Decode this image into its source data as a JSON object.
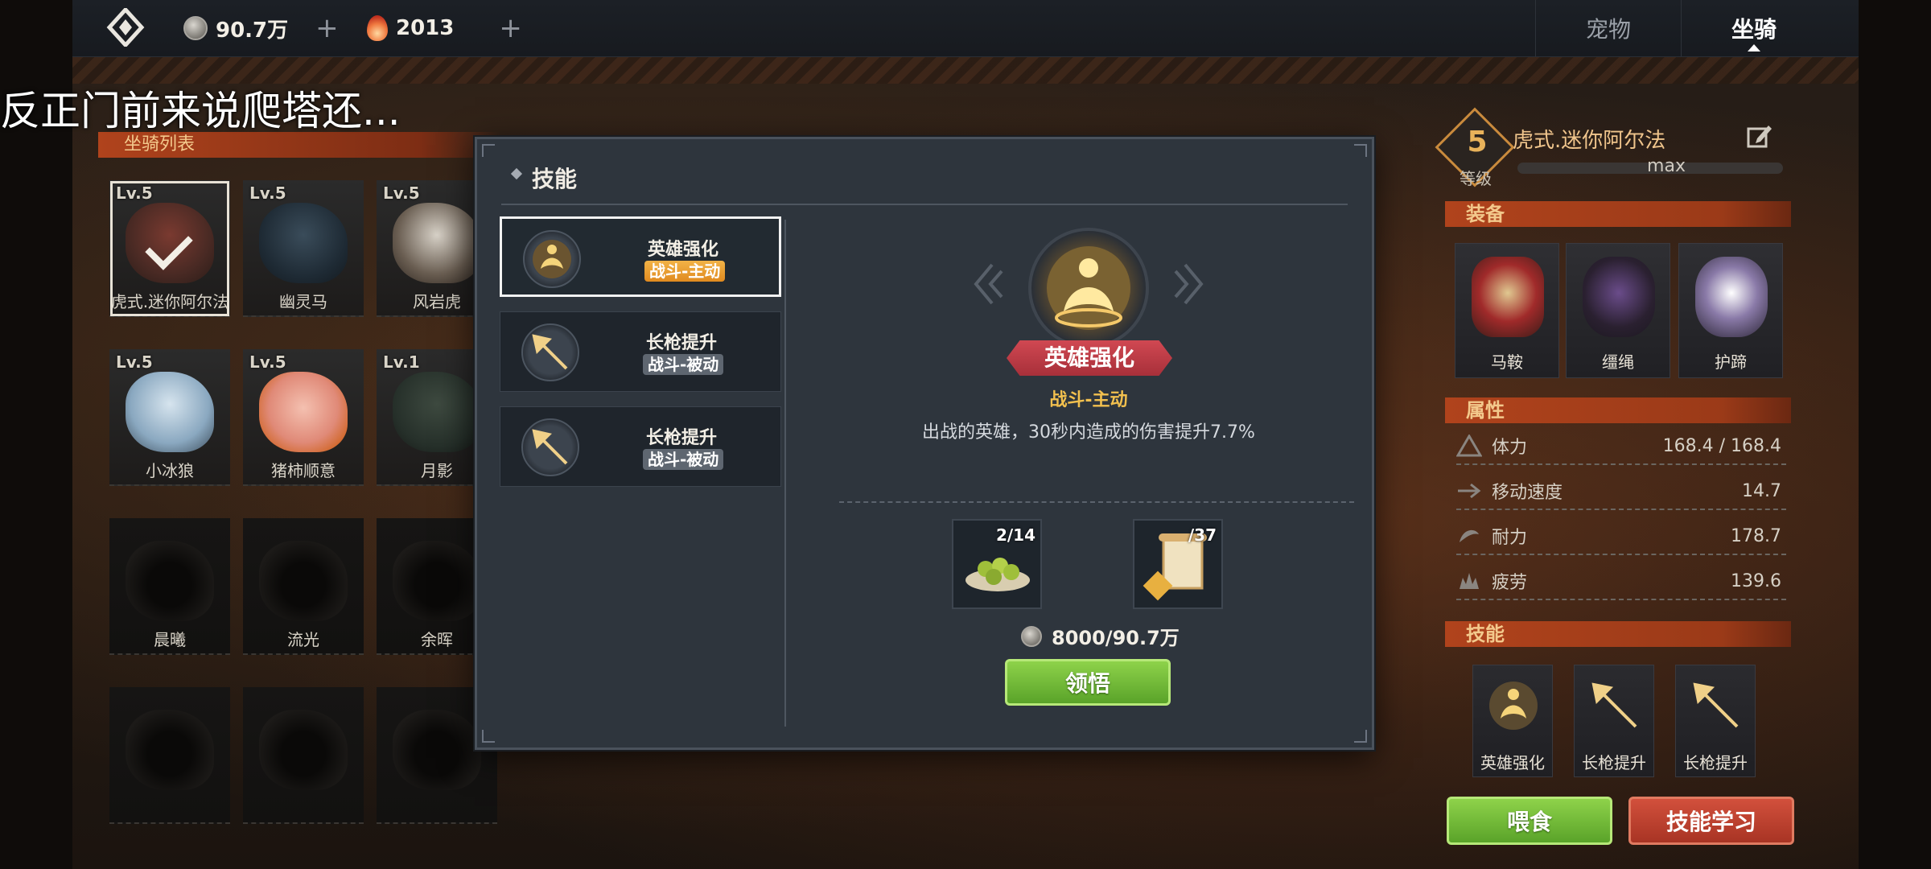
{
  "topbar": {
    "currency_silver": "90.7万",
    "currency_crystal": "2013",
    "plus": "+",
    "tabs": [
      {
        "label": "宠物",
        "active": false
      },
      {
        "label": "坐骑",
        "active": true
      }
    ]
  },
  "subtitle": "反正门前来说爬塔还...",
  "mount_list": {
    "header": "坐骑列表",
    "items": [
      {
        "level": "Lv.5",
        "name": "虎式.迷你阿尔法",
        "selected": true
      },
      {
        "level": "Lv.5",
        "name": "幽灵马"
      },
      {
        "level": "Lv.5",
        "name": "风岩虎"
      },
      {
        "level": "Lv.5",
        "name": "小冰狼"
      },
      {
        "level": "Lv.5",
        "name": "猪柿顺意"
      },
      {
        "level": "Lv.1",
        "name": "月影"
      },
      {
        "level": "",
        "name": "晨曦"
      },
      {
        "level": "",
        "name": "流光"
      },
      {
        "level": "",
        "name": "余晖"
      },
      {
        "level": "",
        "name": ""
      },
      {
        "level": "",
        "name": ""
      },
      {
        "level": "",
        "name": ""
      }
    ]
  },
  "detail_panel": {
    "level": "5",
    "level_label": "等级",
    "mount_name": "虎式.迷你阿尔法",
    "max_label": "max",
    "equipment_header": "装备",
    "equipment": [
      {
        "name": "马鞍"
      },
      {
        "name": "缰绳"
      },
      {
        "name": "护蹄"
      }
    ],
    "attributes_header": "属性",
    "attributes": [
      {
        "label": "体力",
        "value": "168.4 / 168.4"
      },
      {
        "label": "移动速度",
        "value": "14.7"
      },
      {
        "label": "耐力",
        "value": "178.7"
      },
      {
        "label": "疲劳",
        "value": "139.6"
      }
    ],
    "skills_header": "技能",
    "skills": [
      {
        "name": "英雄强化"
      },
      {
        "name": "长枪提升"
      },
      {
        "name": "长枪提升"
      }
    ],
    "feed_button": "喂食",
    "learn_button": "技能学习"
  },
  "skill_modal": {
    "title": "技能",
    "skills": [
      {
        "name": "英雄强化",
        "tag": "战斗-主动",
        "active": true
      },
      {
        "name": "长枪提升",
        "tag": "战斗-被动",
        "active": false
      },
      {
        "name": "长枪提升",
        "tag": "战斗-被动",
        "active": false
      }
    ],
    "detail": {
      "name": "英雄强化",
      "tag": "战斗-主动",
      "description": "出战的英雄，30秒内造成的伤害提升7.7%"
    },
    "materials": [
      {
        "count": "2/14",
        "icon": "olives-plate-icon"
      },
      {
        "count": "/37",
        "icon": "skill-scroll-icon"
      }
    ],
    "cost": "8000/90.7万",
    "comprehend_button": "领悟"
  },
  "colors": {
    "accent_orange": "#b0431c",
    "gold": "#f2c04e",
    "green_button": "#6fbf35",
    "red_button": "#c0402e",
    "modal_bg": "#2e353d"
  }
}
